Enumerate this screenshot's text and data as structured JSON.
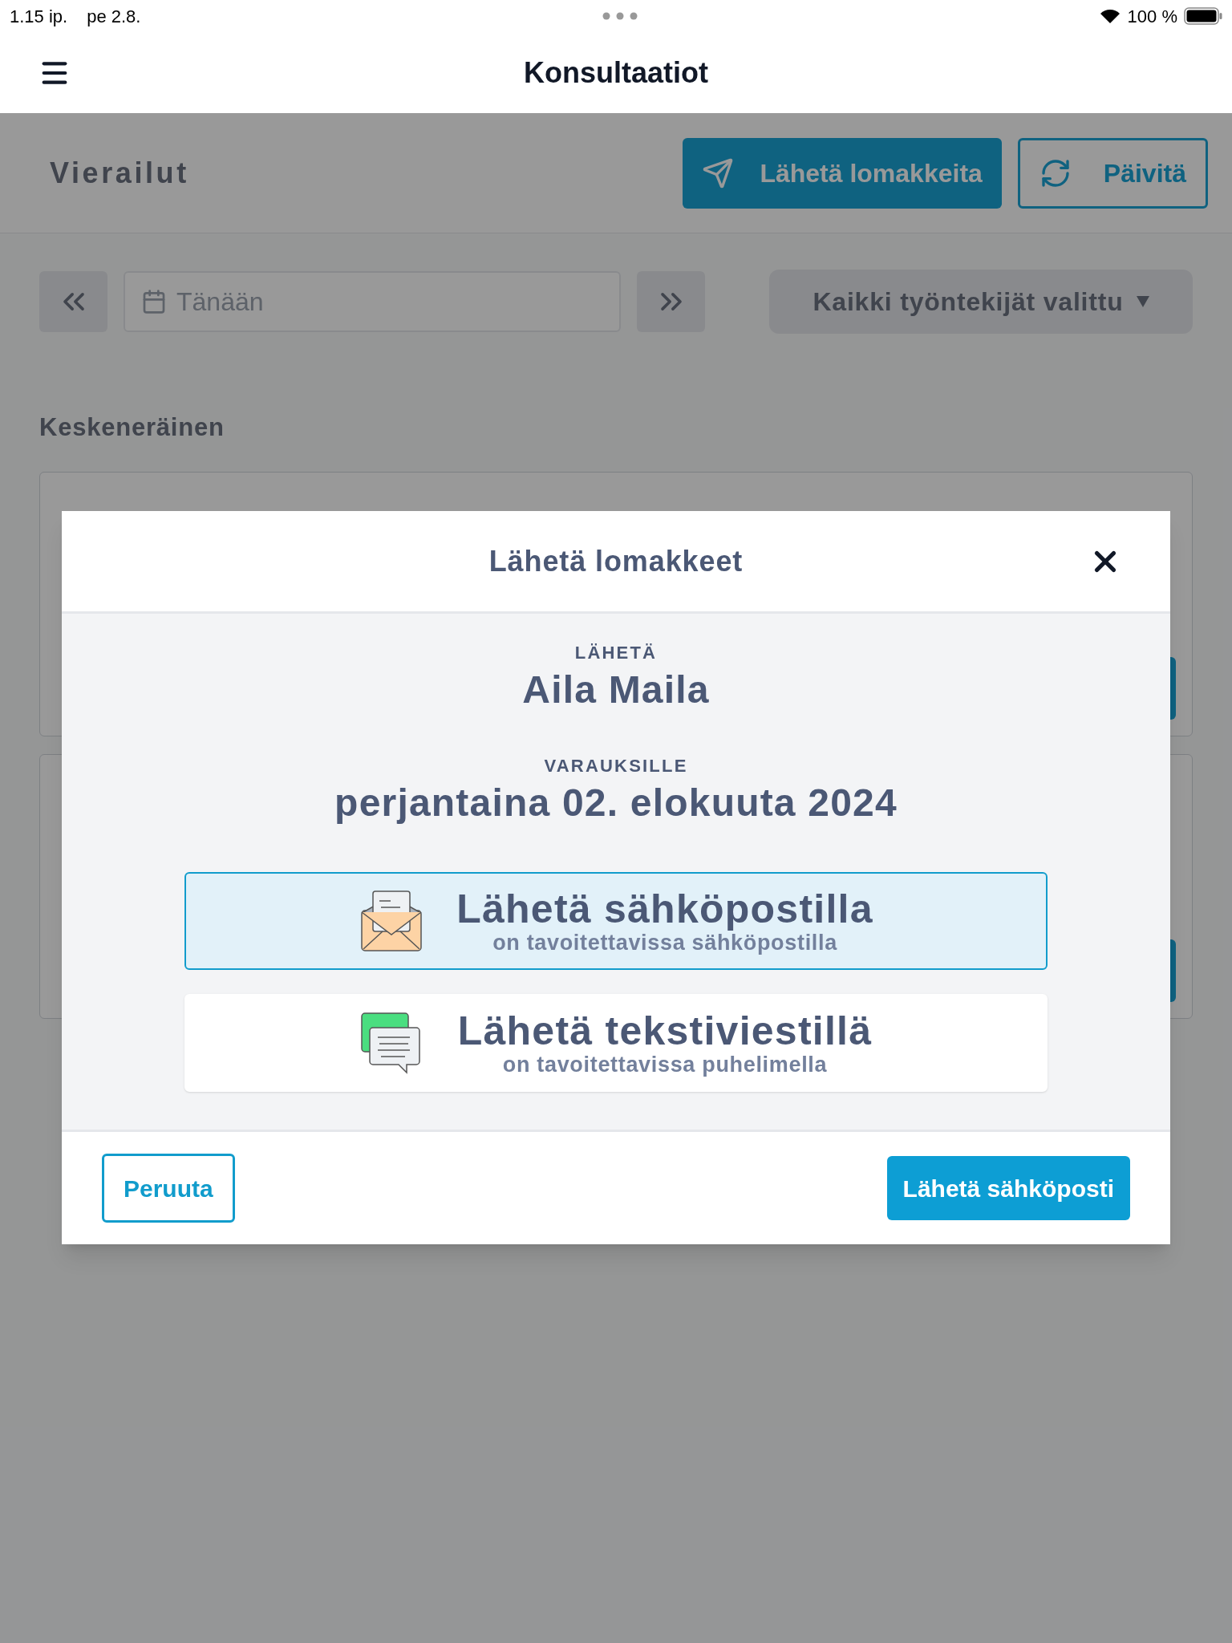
{
  "status_bar": {
    "time": "1.15 ip.",
    "date": "pe 2.8.",
    "battery": "100 %"
  },
  "header": {
    "title": "Konsultaatiot"
  },
  "page": {
    "title": "Vierailut",
    "send_forms_button": "Lähetä lomakkeita",
    "refresh_button": "Päivitä",
    "date_field": {
      "placeholder": "Tänään"
    },
    "employee_select": "Kaikki työntekijät valittu",
    "section_title": "Keskeneräinen"
  },
  "modal": {
    "title": "Lähetä lomakkeet",
    "recipient_label": "LÄHETÄ",
    "recipient": "Aila Maila",
    "date_label": "VARAUKSILLE",
    "date": "perjantaina 02. elokuuta 2024",
    "options": [
      {
        "kind": "email",
        "title": "Lähetä sähköpostilla",
        "subtitle": "on tavoitettavissa sähköpostilla",
        "selected": true
      },
      {
        "kind": "sms",
        "title": "Lähetä tekstiviestillä",
        "subtitle": "on tavoitettavissa puhelimella",
        "selected": false
      }
    ],
    "cancel_button": "Peruuta",
    "confirm_button": "Lähetä sähköposti"
  }
}
